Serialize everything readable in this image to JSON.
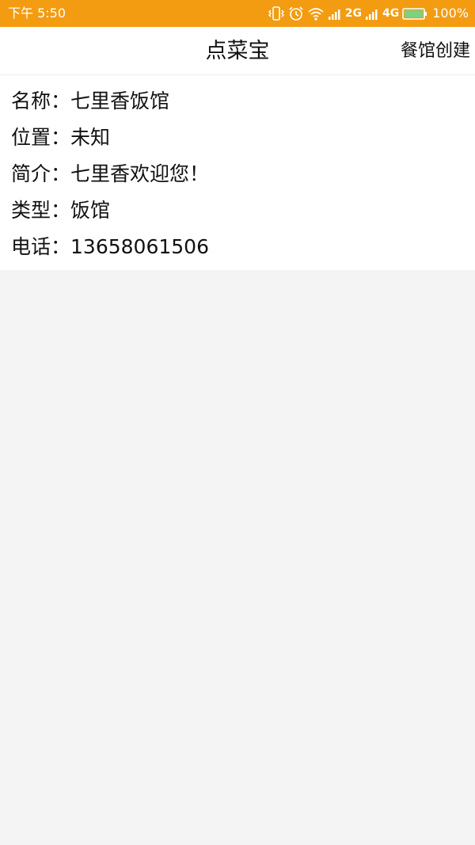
{
  "status_bar": {
    "time": "下午 5:50",
    "net1": "2G",
    "net2": "4G",
    "battery": "100%",
    "icons": [
      "vibrate-icon",
      "alarm-icon",
      "wifi-icon",
      "signal-icon",
      "battery-icon"
    ]
  },
  "header": {
    "title": "点菜宝",
    "action_label": "餐馆创建"
  },
  "restaurant": {
    "name_label": "名称：",
    "name": "七里香饭馆",
    "location_label": "位置：",
    "location": "未知",
    "intro_label": "简介：",
    "intro": "七里香欢迎您！",
    "type_label": "类型：",
    "type": "饭馆",
    "phone_label": "电话：",
    "phone": "13658061506"
  },
  "colors": {
    "status_bar": "#f39c12",
    "page_background": "#f4f4f4",
    "panel_background": "#ffffff",
    "text": "#111111",
    "battery_fill": "#7ed17e"
  }
}
